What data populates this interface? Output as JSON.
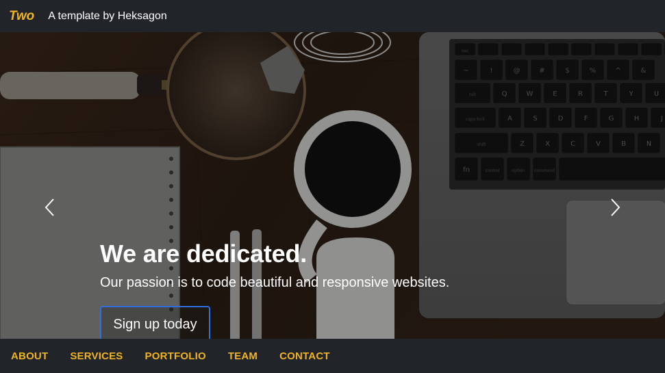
{
  "header": {
    "brand": "Two",
    "tagline": "A template by Heksagon"
  },
  "hero": {
    "heading": "We are dedicated.",
    "subheading": "Our passion is to code beautiful and responsive websites.",
    "cta_label": "Sign up today",
    "keyboard_rows": [
      [
        "esc",
        "",
        "",
        "",
        "",
        "",
        "",
        "",
        "",
        "",
        ""
      ],
      [
        "~",
        "!",
        "@",
        "#",
        "$",
        "%",
        "^",
        "&"
      ],
      [
        "tab",
        "Q",
        "W",
        "E",
        "R",
        "T",
        "Y",
        "U"
      ],
      [
        "caps lock",
        "A",
        "S",
        "D",
        "F",
        "G",
        "H",
        "J"
      ],
      [
        "shift",
        "Z",
        "X",
        "C",
        "V",
        "B",
        "N"
      ],
      [
        "fn",
        "control",
        "option",
        "command",
        ""
      ]
    ]
  },
  "nav": {
    "items": [
      "ABOUT",
      "SERVICES",
      "PORTFOLIO",
      "TEAM",
      "CONTACT"
    ]
  },
  "colors": {
    "accent": "#f0b323",
    "bar_bg": "#212529",
    "cta_border": "#2f6fe0"
  }
}
